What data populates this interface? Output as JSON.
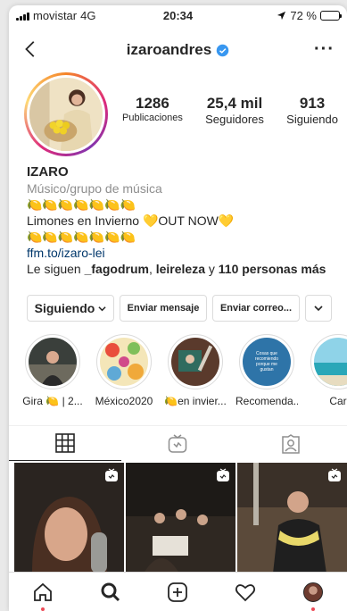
{
  "status_bar": {
    "carrier": "movistar",
    "network": "4G",
    "time": "20:34",
    "battery_text": "72 %",
    "battery_level": 0.72
  },
  "header": {
    "username": "izaroandres",
    "verified": true,
    "more_label": "···"
  },
  "stats": [
    {
      "number": "1286",
      "label": "Publicaciones"
    },
    {
      "number": "25,4 mil",
      "label": "Seguidores"
    },
    {
      "number": "913",
      "label": "Siguiendo"
    }
  ],
  "bio": {
    "name": "IZARO",
    "category": "Músico/grupo de música",
    "emoji_line_1": "🍋🍋🍋🍋🍋🍋🍋",
    "line_2": "Limones en Invierno 💛OUT NOW💛",
    "emoji_line_3": "🍋🍋🍋🍋🍋🍋🍋",
    "link": "ffm.to/izaro-lei",
    "followed_by_prefix": "Le siguen ",
    "followed_by_names": "_fagodrum",
    "followed_by_sep": ", ",
    "followed_by_names_2": "leireleza",
    "followed_by_and": " y ",
    "followed_by_more": "110 personas más"
  },
  "buttons": {
    "following": "Siguiendo",
    "message": "Enviar mensaje",
    "email": "Enviar correo..."
  },
  "highlights": [
    {
      "label": "Gira 🍋 | 2..."
    },
    {
      "label": "México2020"
    },
    {
      "label": "🍋en invier..."
    },
    {
      "label": "Recomenda...",
      "inner_text": "Cosas que recomiendo porque me gustan"
    },
    {
      "label": "Car"
    }
  ],
  "tabs": [
    "grid-icon",
    "igtv-icon",
    "tagged-icon"
  ],
  "bottom_nav": [
    "home-icon",
    "search-icon",
    "new-post-icon",
    "activity-icon",
    "profile-avatar"
  ]
}
